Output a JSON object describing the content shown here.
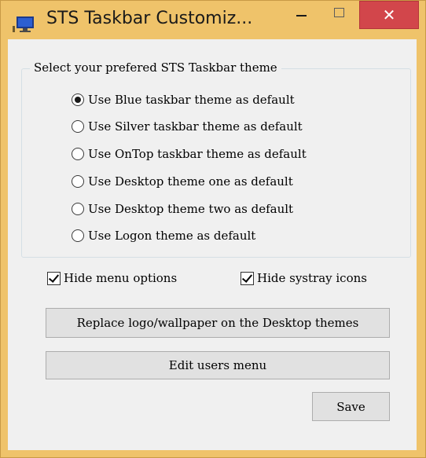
{
  "window": {
    "title": "STS Taskbar Customiz...",
    "close_glyph": "✕",
    "icons": {
      "app": "computer-monitor-icon",
      "minimize": "minimize-icon",
      "maximize": "maximize-icon",
      "close": "close-icon"
    }
  },
  "colors": {
    "frame": "#efc36a",
    "close_button": "#d2464b",
    "client_bg": "#f0f0f0"
  },
  "theme_group": {
    "legend": "Select your prefered STS Taskbar theme",
    "selected_index": 0,
    "options": [
      "Use Blue taskbar theme as default",
      "Use Silver taskbar theme as default",
      "Use OnTop taskbar theme as default",
      "Use Desktop theme one as default",
      "Use Desktop theme two as default",
      "Use Logon theme as default"
    ]
  },
  "checkboxes": {
    "hide_menu_options": {
      "label": "Hide menu options",
      "checked": true
    },
    "hide_systray_icons": {
      "label": "Hide systray icons",
      "checked": true
    }
  },
  "buttons": {
    "replace_logo": "Replace logo/wallpaper on the Desktop themes",
    "edit_users_menu": "Edit users menu",
    "save": "Save"
  }
}
